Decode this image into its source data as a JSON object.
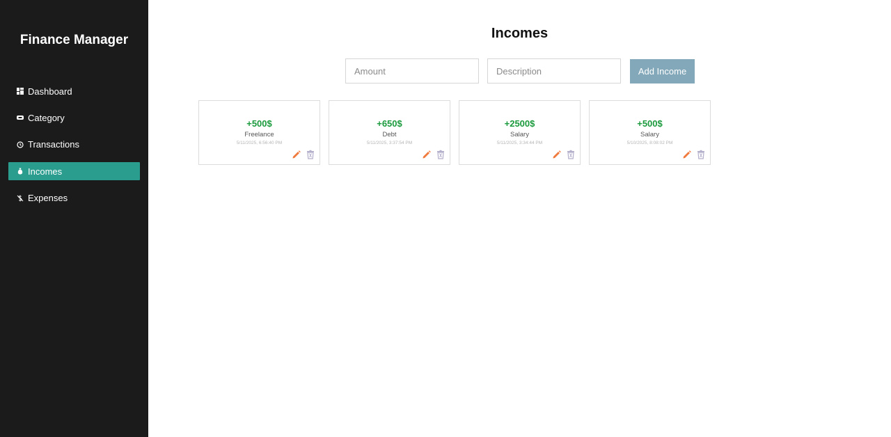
{
  "app": {
    "title": "Finance Manager"
  },
  "sidebar": {
    "items": [
      {
        "label": "Dashboard",
        "icon": "grid-icon",
        "active": false
      },
      {
        "label": "Category",
        "icon": "tag-icon",
        "active": false
      },
      {
        "label": "Transactions",
        "icon": "history-icon",
        "active": false
      },
      {
        "label": "Incomes",
        "icon": "money-bag-icon",
        "active": true
      },
      {
        "label": "Expenses",
        "icon": "dollar-slash-icon",
        "active": false
      }
    ]
  },
  "main": {
    "title": "Incomes",
    "form": {
      "amount_placeholder": "Amount",
      "description_placeholder": "Description",
      "add_label": "Add Income"
    },
    "incomes": [
      {
        "amount": "+500$",
        "description": "Freelance",
        "date": "5/11/2025, 6:56:40 PM"
      },
      {
        "amount": "+650$",
        "description": "Debt",
        "date": "5/11/2025, 3:37:54 PM"
      },
      {
        "amount": "+2500$",
        "description": "Salary",
        "date": "5/11/2025, 3:34:44 PM"
      },
      {
        "amount": "+500$",
        "description": "Salary",
        "date": "5/10/2025, 8:08:02 PM"
      }
    ]
  },
  "colors": {
    "sidebar_bg": "#1b1b1b",
    "active_item": "#2a9d8f",
    "amount_green": "#1a9a3c",
    "button_bg": "#83a8ba",
    "edit_icon": "#f07a3c",
    "delete_icon": "#b3aecb"
  }
}
